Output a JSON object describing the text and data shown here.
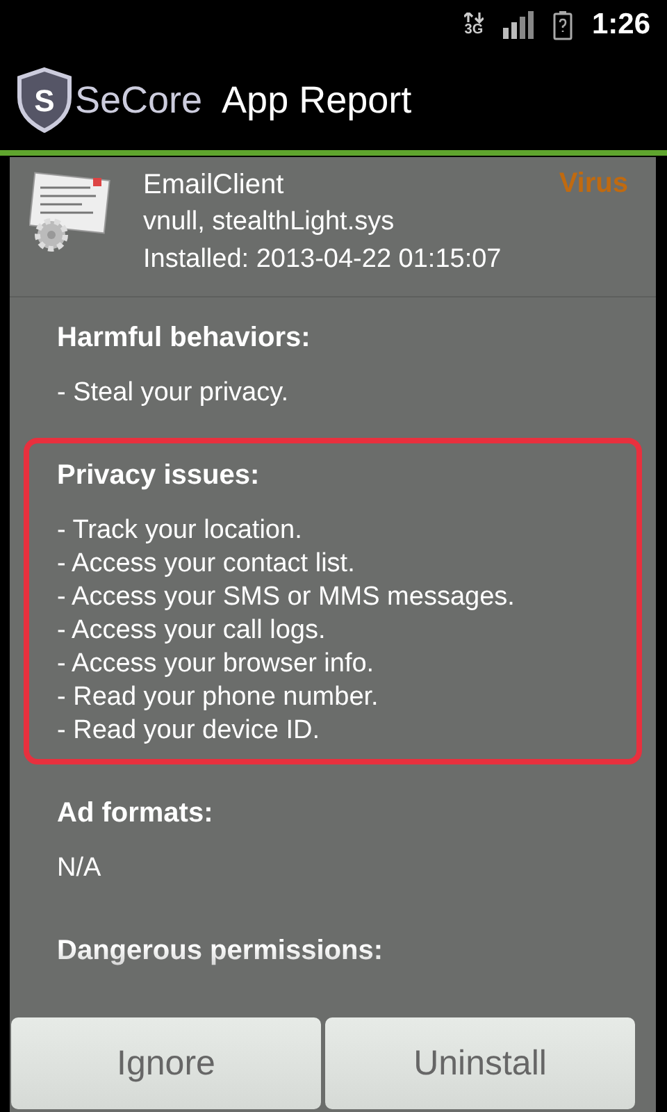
{
  "status_bar": {
    "network": "3G",
    "time": "1:26"
  },
  "app_bar": {
    "logo_letter": "S",
    "brand": "SeCore",
    "title": "App Report"
  },
  "app": {
    "name": "EmailClient",
    "detail": "vnull, stealthLight.sys",
    "installed": "Installed: 2013-04-22 01:15:07",
    "threat": "Virus"
  },
  "sections": [
    {
      "title": "Harmful behaviors:",
      "highlighted": false,
      "items": [
        "- Steal your privacy."
      ]
    },
    {
      "title": "Privacy issues:",
      "highlighted": true,
      "items": [
        "- Track your location.",
        "- Access your contact list.",
        "- Access your SMS or MMS messages.",
        "- Access your call logs.",
        "- Access your browser info.",
        "- Read your phone number.",
        "- Read your device ID."
      ]
    },
    {
      "title": "Ad formats:",
      "highlighted": false,
      "items": [
        "N/A"
      ]
    },
    {
      "title": "Dangerous permissions:",
      "highlighted": false
    }
  ],
  "buttons": [
    {
      "label": "Ignore"
    },
    {
      "label": "Uninstall"
    }
  ]
}
